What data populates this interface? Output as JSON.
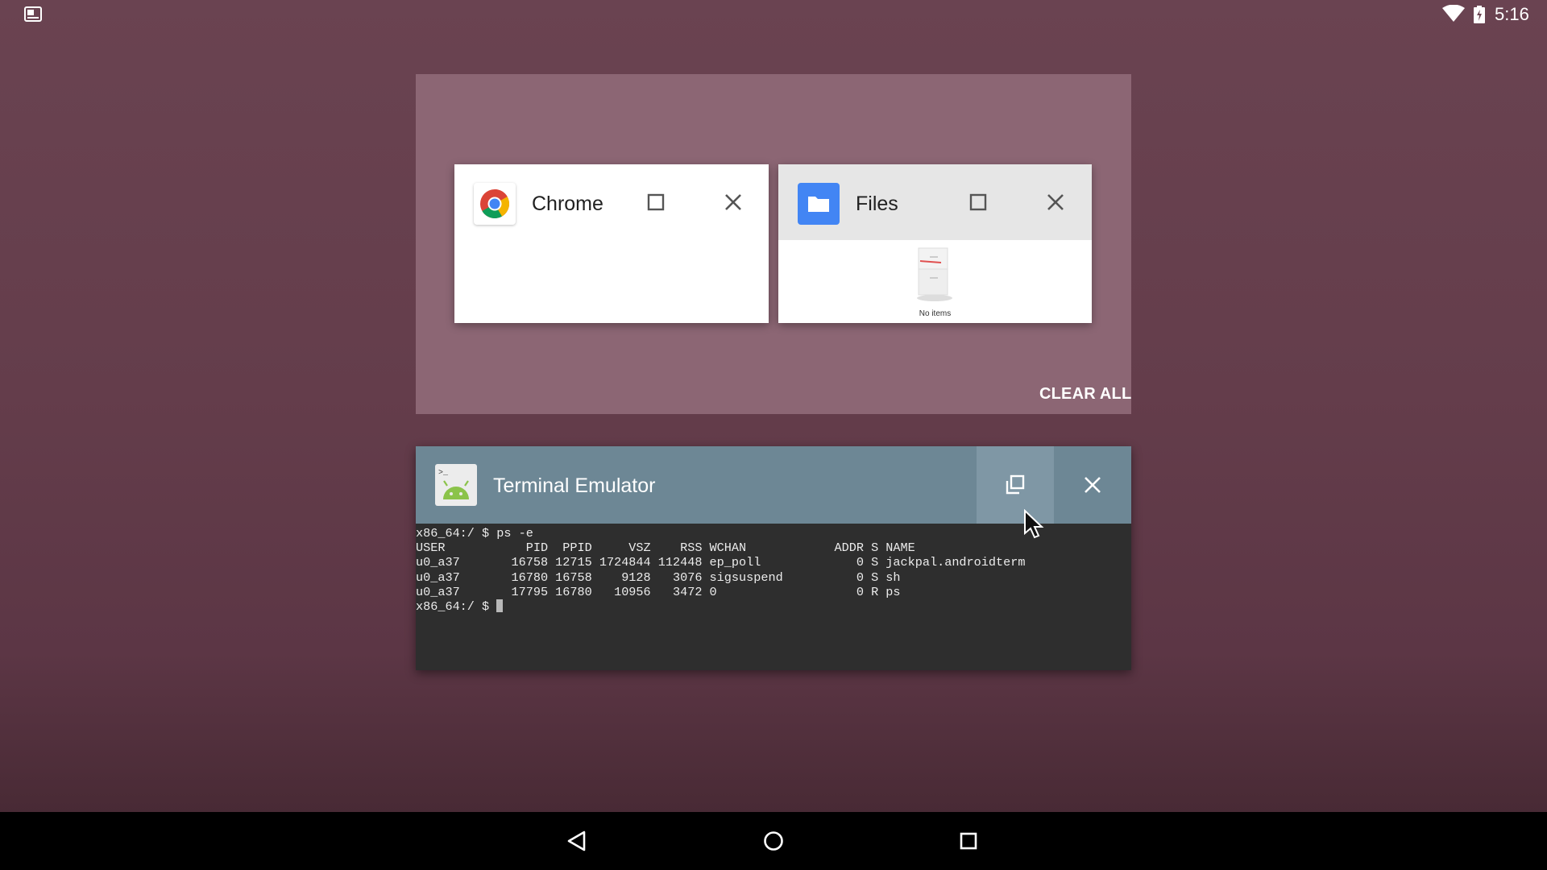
{
  "status_bar": {
    "time": "5:16",
    "icons": [
      "notification-screenshot-icon",
      "wifi-icon",
      "battery-icon"
    ]
  },
  "recents": {
    "clear_all_label": "CLEAR ALL",
    "tasks": [
      {
        "app": "Chrome",
        "icon": "chrome-icon"
      },
      {
        "app": "Files",
        "icon": "folder-icon",
        "content_text": "No items"
      }
    ]
  },
  "terminal": {
    "title": "Terminal Emulator",
    "icon": "terminal-android-icon",
    "lines": [
      "x86_64:/ $ ps -e",
      "USER           PID  PPID     VSZ    RSS WCHAN            ADDR S NAME",
      "u0_a37       16758 12715 1724844 112448 ep_poll             0 S jackpal.androidterm",
      "u0_a37       16780 16758    9128   3076 sigsuspend          0 S sh",
      "u0_a37       17795 16780   10956   3472 0                   0 R ps"
    ],
    "prompt": "x86_64:/ $ "
  },
  "nav_bar": {
    "buttons": [
      "back-icon",
      "home-icon",
      "recents-icon"
    ]
  },
  "colors": {
    "background": "#643d4b",
    "workspace": "#8c6674",
    "terminal_header": "#6d8795",
    "terminal_body": "#2e2e2e",
    "files_blue": "#4285f4"
  }
}
